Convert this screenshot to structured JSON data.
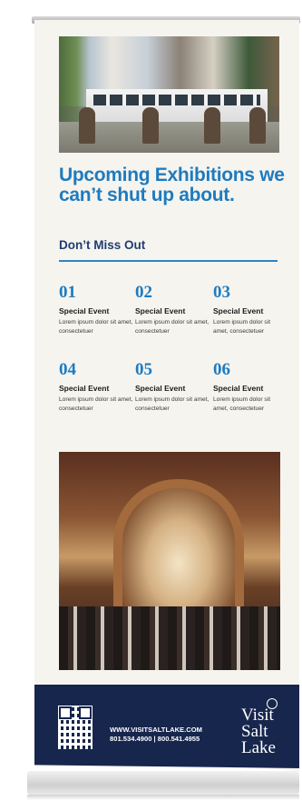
{
  "banner": {
    "headline": "Upcoming Exhibitions we can’t shut up about.",
    "subhead": "Don’t Miss Out",
    "events": [
      {
        "number": "01",
        "title": "Special Event",
        "description": "Lorem ipsum dolor sit amet, consectetuer"
      },
      {
        "number": "02",
        "title": "Special Event",
        "description": "Lorem ipsum dolor sit amet, consectetuer"
      },
      {
        "number": "03",
        "title": "Special Event",
        "description": "Lorem ipsum dolor sit amet, consectetuer"
      },
      {
        "number": "04",
        "title": "Special Event",
        "description": "Lorem ipsum dolor sit amet, consectetuer"
      },
      {
        "number": "05",
        "title": "Special Event",
        "description": "Lorem ipsum dolor sit amet, consectetuer"
      },
      {
        "number": "06",
        "title": "Special Event",
        "description": "Lorem ipsum dolor sit amet, consectetuer"
      }
    ],
    "footer": {
      "website": "WWW.VISITSALTLAKE.COM",
      "phones": "801.534.4900 | 800.541.4955",
      "brand_line1": "Visit",
      "brand_line2": "Salt",
      "brand_line3": "Lake"
    }
  },
  "colors": {
    "accent_blue": "#1e7bbf",
    "navy": "#17264d",
    "banner_bg": "#f6f4ef"
  }
}
